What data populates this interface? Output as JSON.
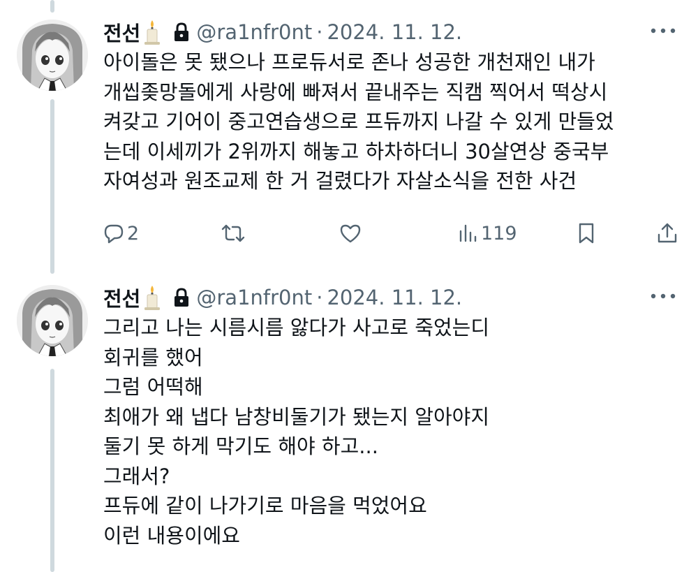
{
  "tweets": [
    {
      "display_name": "전선",
      "candle_icon": "candle-icon",
      "lock_icon": "lock-icon",
      "handle": "@ra1nfr0nt",
      "separator": "·",
      "date": "2024. 11. 12.",
      "lines": [
        "아이돌은 못 됐으나 프로듀서로 존나 성공한 개천재인 내가",
        "개씹좆망돌에게 사랑에 빠져서 끝내주는 직캠 찍어서 떡상시",
        "켜갖고 기어이 중고연습생으로 프듀까지 나갈 수 있게 만들었",
        "는데 이세끼가 2위까지 해놓고 하차하더니 30살연상 중국부",
        "자여성과 원조교제 한 거 걸렸다가 자살소식을 전한 사건"
      ],
      "actions": {
        "reply_count": "2",
        "retweet_count": "",
        "like_count": "",
        "views_count": "119"
      }
    },
    {
      "display_name": "전선",
      "candle_icon": "candle-icon",
      "lock_icon": "lock-icon",
      "handle": "@ra1nfr0nt",
      "separator": "·",
      "date": "2024. 11. 12.",
      "lines": [
        "그리고 나는 시름시름 앓다가 사고로 죽었는디",
        "회귀를 했어",
        "그럼 어떡해",
        "최애가 왜 냅다 남창비둘기가 됐는지 알아야지",
        "둘기 못 하게 막기도 해야 하고...",
        "그래서?",
        "프듀에 같이 나가기로 마음을 먹었어요",
        "이런 내용이에요"
      ]
    }
  ],
  "colors": {
    "text": "#0f1419",
    "secondary": "#536471",
    "thread_line": "#cfd9de"
  }
}
